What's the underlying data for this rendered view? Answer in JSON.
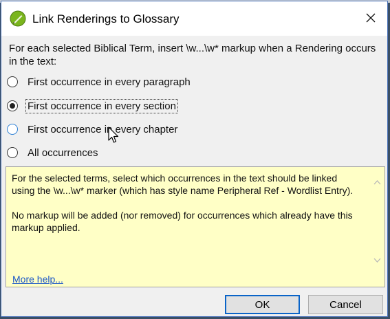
{
  "window": {
    "title": "Link Renderings to Glossary"
  },
  "prompt": "For each selected Biblical Term, insert \\w...\\w* markup when a Rendering occurs in the text:",
  "options": [
    {
      "label": "First occurrence in every paragraph",
      "selected": false
    },
    {
      "label": "First occurrence in every section",
      "selected": true
    },
    {
      "label": "First occurrence in every chapter",
      "selected": false
    },
    {
      "label": "All occurrences",
      "selected": false
    }
  ],
  "help": {
    "text": "For the selected terms, select which occurrences in the text should be linked using the \\w...\\w* marker (which has style name Peripheral Ref - Wordlist Entry).\n\nNo markup will be added (nor removed) for occurrences which already have this markup applied.",
    "more_help": "More help..."
  },
  "buttons": {
    "ok": "OK",
    "cancel": "Cancel"
  },
  "colors": {
    "accent": "#0a64c8",
    "help_bg": "#ffffc6",
    "link": "#1a56c7",
    "icon_green": "#7ab51d"
  },
  "icons": {
    "app": "leaf-pen-icon",
    "close": "close-icon",
    "cursor": "mouse-pointer-icon"
  }
}
